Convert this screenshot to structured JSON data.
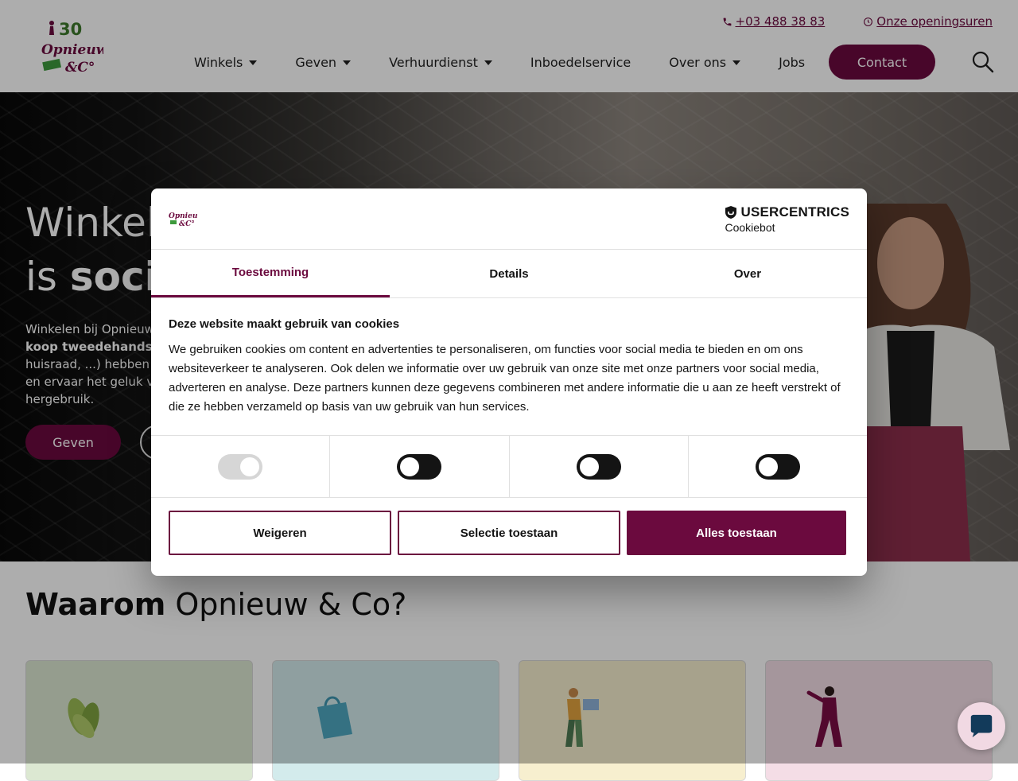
{
  "colors": {
    "brand": "#6b0a3e",
    "text": "#1f1f1f"
  },
  "header": {
    "phone": "+03 488 38 83",
    "hours_link": "Onze openingsuren",
    "nav": [
      {
        "label": "Winkels",
        "dropdown": true
      },
      {
        "label": "Geven",
        "dropdown": true
      },
      {
        "label": "Verhuurdienst",
        "dropdown": true
      },
      {
        "label": "Inboedelservice",
        "dropdown": false
      },
      {
        "label": "Over ons",
        "dropdown": true
      },
      {
        "label": "Jobs",
        "dropdown": false
      }
    ],
    "contact_label": "Contact",
    "logo_number": "30",
    "logo_text_1": "Opnieuw",
    "logo_text_2": "&C°"
  },
  "hero": {
    "title_line1": "Winkel",
    "title_line2_pre": "is ",
    "title_line2_bold": "socia",
    "text_line1": "Winkelen bij Opnieuw",
    "text_line2_bold": "koop tweedehands",
    "text_line2_rest": ".",
    "text_line3": "huisraad, ...) hebben e",
    "text_line4": "en ervaar het geluk va",
    "text_line5": "hergebruik.",
    "primary_button": "Geven"
  },
  "why": {
    "title_bold": "Waarom",
    "title_rest": " Opnieuw & Co?"
  },
  "cookie_dialog": {
    "brand_name": "USERCENTRICS",
    "brand_sub": "Cookiebot",
    "tabs": [
      {
        "label": "Toestemming",
        "active": true
      },
      {
        "label": "Details",
        "active": false
      },
      {
        "label": "Over",
        "active": false
      }
    ],
    "heading": "Deze website maakt gebruik van cookies",
    "body": "We gebruiken cookies om content en advertenties te personaliseren, om functies voor social media te bieden en om ons websiteverkeer te analyseren. Ook delen we informatie over uw gebruik van onze site met onze partners voor social media, adverteren en analyse. Deze partners kunnen deze gegevens combineren met andere informatie die u aan ze heeft verstrekt of die ze hebben verzameld op basis van uw gebruik van hun services.",
    "toggles": [
      {
        "name": "necessary",
        "enabled": true,
        "disabled": true
      },
      {
        "name": "preferences",
        "enabled": false,
        "disabled": false
      },
      {
        "name": "statistics",
        "enabled": false,
        "disabled": false
      },
      {
        "name": "marketing",
        "enabled": false,
        "disabled": false
      }
    ],
    "buttons": {
      "deny": "Weigeren",
      "selection": "Selectie toestaan",
      "allow_all": "Alles toestaan"
    }
  },
  "cards": [
    {
      "icon": "leaves-icon",
      "bg": "#dce8d2"
    },
    {
      "icon": "shopping-bag-icon",
      "bg": "#d3ebec"
    },
    {
      "icon": "person-carrying-icon",
      "bg": "#f7efcf"
    },
    {
      "icon": "person-pointing-icon",
      "bg": "#f4dde6"
    }
  ]
}
